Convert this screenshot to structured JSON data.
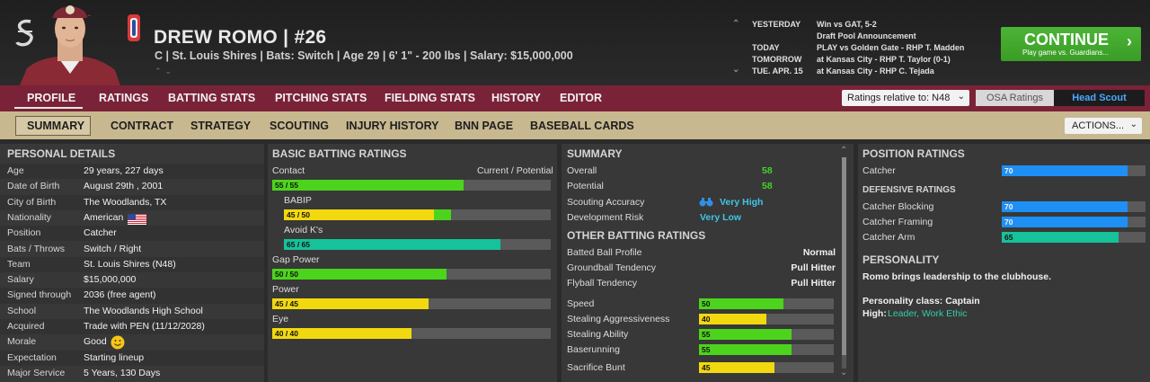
{
  "header": {
    "player_name": "DREW ROMO  |  #26",
    "player_sub": "C | St. Louis Shires  |  Bats: Switch  |  Age 29  |  6' 1\" - 200 lbs  |  Salary: $15,000,000",
    "schedule": [
      {
        "day": "YESTERDAY",
        "event": "Win vs GAT, 5-2"
      },
      {
        "day": "",
        "event": "Draft Pool Announcement"
      },
      {
        "day": "TODAY",
        "event": "PLAY vs Golden Gate - RHP T. Madden"
      },
      {
        "day": "TOMORROW",
        "event": "at Kansas City - RHP T. Taylor (0-1)"
      },
      {
        "day": "TUE. APR. 15",
        "event": "at Kansas City - RHP C. Tejada"
      }
    ],
    "continue_label": "CONTINUE",
    "continue_sub": "Play game vs. Guardians..."
  },
  "main_tabs": [
    "PROFILE",
    "RATINGS",
    "BATTING STATS",
    "PITCHING STATS",
    "FIELDING STATS",
    "HISTORY",
    "EDITOR"
  ],
  "ratings_relative": "Ratings relative to: N48",
  "osa_label": "OSA Ratings",
  "scout_label": "Head Scout",
  "sub_tabs": [
    "SUMMARY",
    "CONTRACT",
    "STRATEGY",
    "SCOUTING",
    "INJURY HISTORY",
    "BNN PAGE",
    "BASEBALL CARDS"
  ],
  "actions_label": "ACTIONS...",
  "personal": {
    "title": "PERSONAL DETAILS",
    "rows": [
      {
        "label": "Age",
        "value": "29 years, 227 days"
      },
      {
        "label": "Date of Birth",
        "value": "August 29th , 2001"
      },
      {
        "label": "City of Birth",
        "value": "The Woodlands, TX"
      },
      {
        "label": "Nationality",
        "value": "American"
      },
      {
        "label": "Position",
        "value": "Catcher"
      },
      {
        "label": "Bats / Throws",
        "value": "Switch / Right"
      },
      {
        "label": "Team",
        "value": "St. Louis Shires (N48)"
      },
      {
        "label": "Salary",
        "value": "$15,000,000"
      },
      {
        "label": "Signed through",
        "value": "2036 (free agent)"
      },
      {
        "label": "School",
        "value": "The Woodlands High School"
      },
      {
        "label": "Acquired",
        "value": "Trade with PEN (11/12/2028)"
      },
      {
        "label": "Morale",
        "value": "Good"
      },
      {
        "label": "Expectation",
        "value": "Starting lineup"
      },
      {
        "label": "Major Service",
        "value": "5 Years, 130 Days"
      }
    ]
  },
  "batting": {
    "title": "BASIC BATTING RATINGS",
    "col_header": "Current / Potential",
    "ratings": [
      {
        "label": "Contact",
        "text": "55 / 55",
        "current": 55,
        "potential": 55
      },
      {
        "label": "BABIP",
        "text": "45 / 50",
        "current": 45,
        "potential": 50
      },
      {
        "label": "Avoid K's",
        "text": "65 / 65",
        "current": 65,
        "potential": 65
      },
      {
        "label": "Gap Power",
        "text": "50 / 50",
        "current": 50,
        "potential": 50
      },
      {
        "label": "Power",
        "text": "45 / 45",
        "current": 45,
        "potential": 45
      },
      {
        "label": "Eye",
        "text": "40 / 40",
        "current": 40,
        "potential": 40
      }
    ]
  },
  "summary": {
    "title": "SUMMARY",
    "overall_label": "Overall",
    "overall_value": "58",
    "potential_label": "Potential",
    "potential_value": "58",
    "accuracy_label": "Scouting Accuracy",
    "accuracy_value": "Very High",
    "risk_label": "Development Risk",
    "risk_value": "Very Low",
    "other_title": "OTHER BATTING RATINGS",
    "text_rows": [
      {
        "label": "Batted Ball Profile",
        "value": "Normal"
      },
      {
        "label": "Groundball Tendency",
        "value": "Pull Hitter"
      },
      {
        "label": "Flyball Tendency",
        "value": "Pull Hitter"
      }
    ],
    "bar_rows": [
      {
        "label": "Speed",
        "value": 50
      },
      {
        "label": "Stealing Aggressiveness",
        "value": 40
      },
      {
        "label": "Stealing Ability",
        "value": 55
      },
      {
        "label": "Baserunning",
        "value": 55
      },
      {
        "label": "Sacrifice Bunt",
        "value": 45
      }
    ]
  },
  "position": {
    "title": "POSITION RATINGS",
    "catcher_label": "Catcher",
    "catcher_value": 70,
    "defensive_title": "DEFENSIVE RATINGS",
    "defensive": [
      {
        "label": "Catcher Blocking",
        "value": 70
      },
      {
        "label": "Catcher Framing",
        "value": 70
      },
      {
        "label": "Catcher Arm",
        "value": 65
      }
    ],
    "personality_title": "PERSONALITY",
    "personality_text": "Romo brings leadership to the clubhouse.",
    "personality_class": "Personality class: Captain",
    "high_label": "High:",
    "high_value": "Leader, Work Ethic"
  },
  "colors": {
    "green_bar": "#4cd41d",
    "yellow_bar": "#f1d80f",
    "teal_bar": "#16c29a",
    "blue_bar": "#1e8ff5",
    "tab_maroon": "#7a2238",
    "subtab_tan": "#c8b88f",
    "continue_green": "#3fa52a"
  },
  "icons": [
    "team-logo-icon",
    "usa-flag-icon",
    "smiley-icon",
    "binoculars-icon",
    "chevron-right-icon",
    "chevron-down-icon"
  ]
}
